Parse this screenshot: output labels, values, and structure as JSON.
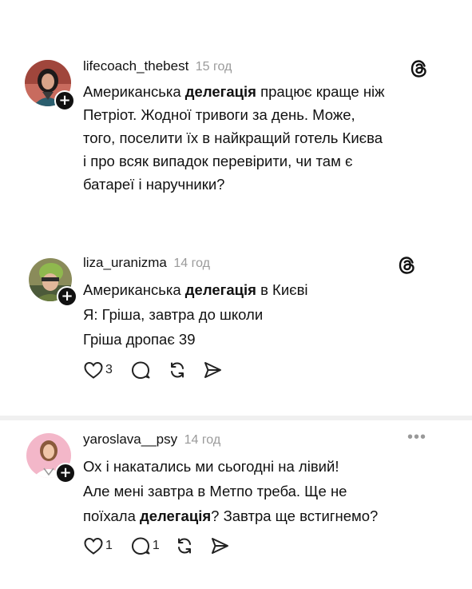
{
  "posts": [
    {
      "username": "lifecoach_thebest",
      "time": "15 год",
      "lines": [
        [
          "Американська ",
          "делегація",
          " працює краще ніж"
        ],
        [
          "Петріот. Жодної тривоги за день. Може,"
        ],
        [
          "того, поселити їх в найкращий готель Києва"
        ],
        [
          "і про всяк випадок перевірити, чи там є"
        ],
        [
          "батареї і наручники?"
        ]
      ]
    },
    {
      "username": "liza_uranizma",
      "time": "14 год",
      "lines": [
        [
          "Американська ",
          "делегація",
          " в Києві"
        ],
        [
          "Я: Гріша, завтра до школи"
        ],
        [
          "Гріша дропає 39"
        ]
      ],
      "likes": "3",
      "replies": ""
    },
    {
      "username": "yaroslava__psy",
      "time": "14 год",
      "lines": [
        [
          "Ох і накатались ми сьогодні на лівий!"
        ],
        [
          "Але мені завтра в Метпо треба. Ще не"
        ],
        [
          "поїхала ",
          "делегація",
          "? Завтра ще встигнемо?"
        ]
      ],
      "likes": "1",
      "replies": "1"
    }
  ],
  "colors": {
    "time": "#9a9a9a",
    "plus_badge": "#111111"
  }
}
